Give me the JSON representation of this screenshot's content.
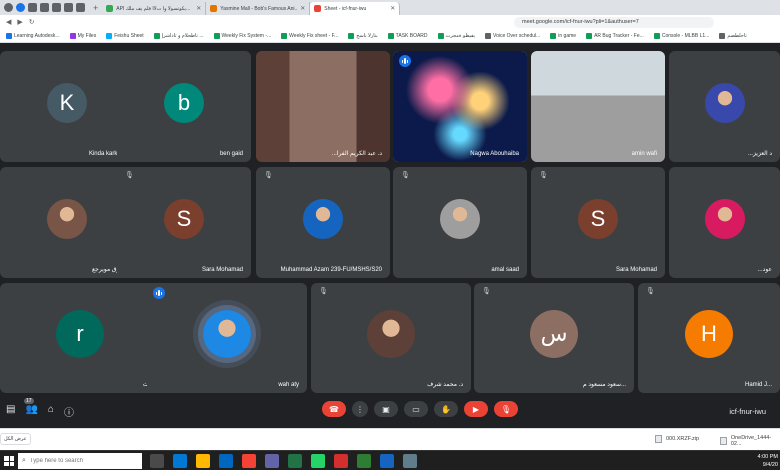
{
  "browser": {
    "tabs": [
      {
        "label": "API يكوتسولا وأ تﻷا فلم يف ملك...",
        "active": false,
        "color": "#34a853"
      },
      {
        "label": "Yasmine Mall - Bob's Famous Ani...",
        "active": false,
        "color": "#e37400"
      },
      {
        "label": "Sheet - icf-fnur-iwu",
        "active": true,
        "color": "#ea4335"
      }
    ],
    "new_tab": "+",
    "url": "meet.google.com/icf-fnur-iwu?pli=1&authuser=7"
  },
  "bookmarks": [
    {
      "label": "Learning Autodesk...",
      "color": "#1a73e8"
    },
    {
      "label": "My Files",
      "color": "#9334e6"
    },
    {
      "label": "Feishu Sheet",
      "color": "#00b0ff"
    },
    {
      "label": "تاظحلام و تاداشرإ ...",
      "color": "#0f9d58"
    },
    {
      "label": "Weekly Fix System -...",
      "color": "#0f9d58"
    },
    {
      "label": "Weekly Fix sheet - F...",
      "color": "#0f9d58"
    },
    {
      "label": "بتارلا باسح",
      "color": "#0f9d58"
    },
    {
      "label": "TASK BOARD",
      "color": "#0f9d58"
    },
    {
      "label": "يفيظو ةمجرت",
      "color": "#0f9d58"
    },
    {
      "label": "Voice Over schedul...",
      "color": "#5f6368"
    },
    {
      "label": "in game",
      "color": "#0f9d58"
    },
    {
      "label": "AR Bug Tracker - Fe...",
      "color": "#0f9d58"
    },
    {
      "label": "Console - MLBB L1...",
      "color": "#0f9d58"
    },
    {
      "label": "تاحلطصم",
      "color": "#5f6368"
    }
  ],
  "participants": [
    {
      "name": "Kinda karkora",
      "initial": "K",
      "avatar_color": "#455a64",
      "kind": "avatar",
      "mic_off": false
    },
    {
      "name": "ben gaid",
      "initial": "b",
      "avatar_color": "#00897b",
      "kind": "avatar",
      "mic_off": false
    },
    {
      "name": "...د. عبد الكريم الفرا",
      "initial": "",
      "avatar_color": "#6d4c41",
      "kind": "video",
      "mic_off": false
    },
    {
      "name": "Nagwa Abouhaiba",
      "initial": "",
      "avatar_color": "#1a237e",
      "kind": "video",
      "mic_off": false,
      "speaking": true
    },
    {
      "name": "amin wafi",
      "initial": "",
      "avatar_color": "#8d8d8d",
      "kind": "video",
      "mic_off": false
    },
    {
      "name": "...د العزيز",
      "initial": "",
      "avatar_color": "#3949ab",
      "kind": "photo",
      "mic_off": false
    },
    {
      "name": "طارق مويرجع",
      "initial": "",
      "avatar_color": "#795548",
      "kind": "photo",
      "mic_off": false
    },
    {
      "name": "Sara Mohamad",
      "initial": "S",
      "avatar_color": "#7b3f2e",
      "kind": "avatar",
      "mic_off": true
    },
    {
      "name": "Muhammad Azam 239-FU/MSHS/S20",
      "initial": "",
      "avatar_color": "#1565c0",
      "kind": "photo",
      "mic_off": true
    },
    {
      "name": "amal saad",
      "initial": "",
      "avatar_color": "#9e9e9e",
      "kind": "photo",
      "mic_off": true
    },
    {
      "name": "Sara Mohamad",
      "initial": "S",
      "avatar_color": "#7b3f2e",
      "kind": "avatar",
      "mic_off": true
    },
    {
      "name": "...عود",
      "initial": "",
      "avatar_color": "#d81b60",
      "kind": "photo",
      "mic_off": false
    },
    {
      "name": "أنت",
      "initial": "r",
      "avatar_color": "#00695c",
      "kind": "avatar",
      "mic_off": false
    },
    {
      "name": "wah aty",
      "initial": "",
      "avatar_color": "#1e88e5",
      "kind": "photo",
      "mic_off": false,
      "talking": true
    },
    {
      "name": "د. محمد شرف",
      "initial": "",
      "avatar_color": "#5d4037",
      "kind": "photo",
      "mic_off": true
    },
    {
      "name": "سعود مسعود م...",
      "initial": "س",
      "avatar_color": "#8d6e63",
      "kind": "avatar",
      "mic_off": true
    },
    {
      "name": "Hamid J...",
      "initial": "H",
      "avatar_color": "#f57c00",
      "kind": "avatar",
      "mic_off": true
    }
  ],
  "controls": {
    "participants_count": "17",
    "meeting_code": "icf-fnur-iwu",
    "buttons": [
      "mic",
      "camera",
      "raise-hand",
      "present",
      "more",
      "leave"
    ]
  },
  "downloads": {
    "left_label": "عرض الكل",
    "items": [
      "000.XRZF.zip",
      "OneDrive_1444-02..."
    ]
  },
  "taskbar": {
    "search_placeholder": "Type here to search",
    "time": "4:00 PM",
    "date": "9/4/20"
  }
}
